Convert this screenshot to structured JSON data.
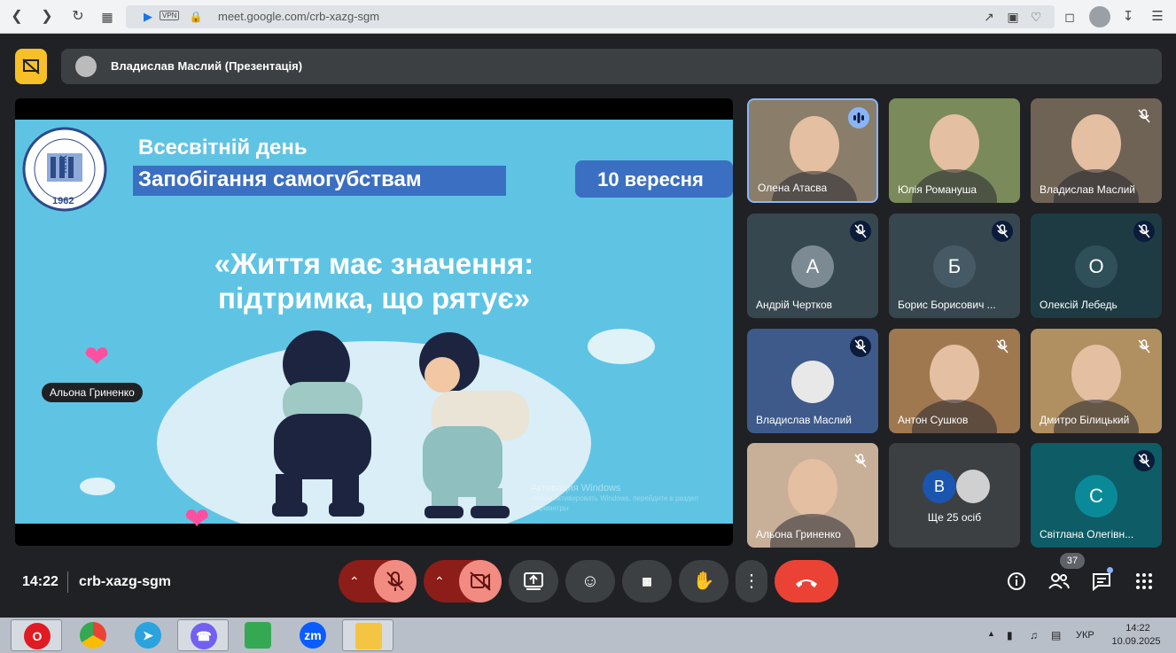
{
  "browser": {
    "url": "meet.google.com/crb-xazg-sgm",
    "vpn_label": "VPN"
  },
  "presenter_bar": {
    "title": "Владислав Маслий (Презентація)"
  },
  "slide": {
    "title_line1": "Всесвітній день",
    "title_line2": "Запобігання самогубствам",
    "date": "10 вересня",
    "quote_line1": "«Життя має значення:",
    "quote_line2": "підтримка, що рятує»",
    "logo_text": "ХНУ",
    "logo_year": "1962",
    "watermark_line1": "Активация Windows",
    "watermark_line2": "Чтобы активировать Windows, перейдите в раздел",
    "watermark_line3": "Параметры"
  },
  "reaction_label": "Альона Гриненко",
  "participants": [
    {
      "name": "Олена Атасва",
      "type": "video",
      "status": "speaking",
      "color": "#8a7e6a"
    },
    {
      "name": "Юлія Романуша",
      "type": "video",
      "status": "",
      "color": "#7a8a5a"
    },
    {
      "name": "Владислав Маслий",
      "type": "video",
      "status": "muted",
      "color": "#6f6355"
    },
    {
      "name": "Андрій Чертков",
      "type": "avatar",
      "initial": "А",
      "status": "muted",
      "color": "#37474f",
      "avatar_color": "#7b8a93"
    },
    {
      "name": "Борис Борисович ...",
      "type": "avatar",
      "initial": "Б",
      "status": "muted",
      "color": "#37474f",
      "avatar_color": "#455a64"
    },
    {
      "name": "Олексій Лебедь",
      "type": "avatar",
      "initial": "О",
      "status": "muted",
      "color": "#1e3b44",
      "avatar_color": "#2f4f59"
    },
    {
      "name": "Владислав Маслий",
      "type": "avatar-photo",
      "status": "muted",
      "color": "#3d5a8a"
    },
    {
      "name": "Антон Сушков",
      "type": "video",
      "status": "muted",
      "color": "#a07850"
    },
    {
      "name": "Дмитро Білицький",
      "type": "video",
      "status": "muted",
      "color": "#b09060"
    },
    {
      "name": "Альона Гриненко",
      "type": "video",
      "status": "muted",
      "color": "#c8b098"
    },
    {
      "name": "Ще 25 осіб",
      "type": "more",
      "initial": "В",
      "status": "",
      "color": "#3c4043"
    },
    {
      "name": "Світлана Олегівн...",
      "type": "avatar",
      "initial": "С",
      "status": "muted",
      "color": "#0d5c66",
      "avatar_color": "#0a8a99"
    }
  ],
  "bottom_bar": {
    "time": "14:22",
    "meeting_code": "crb-xazg-sgm",
    "people_count": "37"
  },
  "taskbar": {
    "lang": "УКР",
    "time": "14:22",
    "date": "10.09.2025",
    "apps": [
      "opera-icon",
      "chrome-icon",
      "telegram-icon",
      "viber-icon",
      "app-icon",
      "zoom-icon",
      "folder-icon"
    ],
    "zoom_label": "zm"
  }
}
